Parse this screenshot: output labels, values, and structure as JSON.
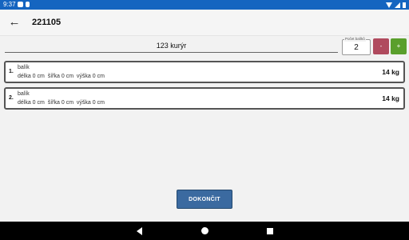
{
  "status_bar": {
    "time": "9:37",
    "icons": [
      "notification-p-icon",
      "sim-icon",
      "wifi-icon",
      "signal-icon",
      "battery-icon"
    ]
  },
  "app_bar": {
    "title": "221105"
  },
  "courier": {
    "name": "123 kurýr"
  },
  "package_count": {
    "legend": "Počet balíků",
    "value": "2"
  },
  "buttons": {
    "minus": "-",
    "plus": "+",
    "finish": "DOKONČIT"
  },
  "items": [
    {
      "index": "1.",
      "name": "balík",
      "dimensions": "délka 0 cm  šířka 0 cm  výška 0 cm",
      "weight": "14 kg"
    },
    {
      "index": "2.",
      "name": "balík",
      "dimensions": "délka 0 cm  šířka 0 cm  výška 0 cm",
      "weight": "14 kg"
    }
  ],
  "colors": {
    "status_bar": "#1565c0",
    "minus_button": "#b04a5e",
    "plus_button": "#5a9f2c",
    "finish_button": "#3b6aa0"
  }
}
